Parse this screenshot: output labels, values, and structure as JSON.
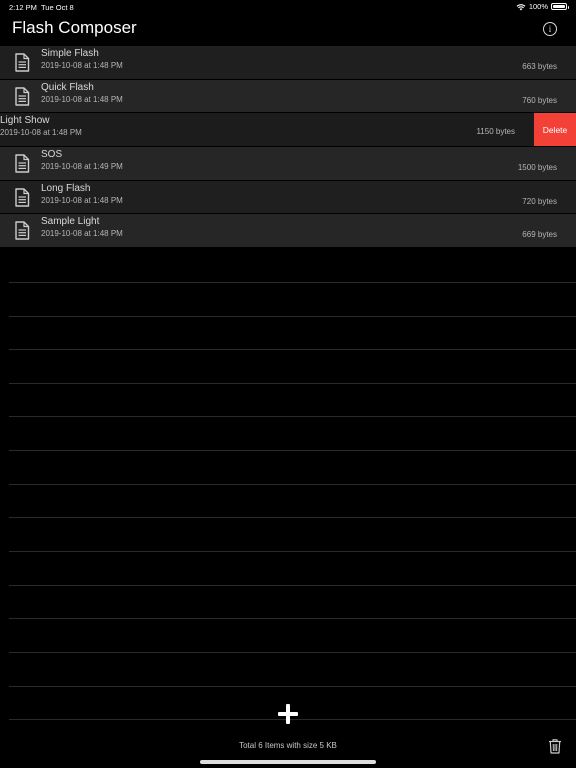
{
  "status_bar": {
    "time": "2:12 PM",
    "date": "Tue Oct 8",
    "battery": "100%"
  },
  "nav": {
    "title": "Flash Composer",
    "info_icon": "info-circle-icon"
  },
  "rows": [
    {
      "title": "Simple Flash",
      "date": "2019-10-08 at 1:48 PM",
      "size": "663 bytes"
    },
    {
      "title": "Quick Flash",
      "date": "2019-10-08 at 1:48 PM",
      "size": "760 bytes"
    },
    {
      "title": "Light Show",
      "date": "2019-10-08 at 1:48 PM",
      "size": "1150 bytes",
      "delete_label": "Delete"
    },
    {
      "title": "SOS",
      "date": "2019-10-08 at 1:49 PM",
      "size": "1500 bytes"
    },
    {
      "title": "Long Flash",
      "date": "2019-10-08 at 1:48 PM",
      "size": "720 bytes"
    },
    {
      "title": "Sample Light",
      "date": "2019-10-08 at 1:48 PM",
      "size": "669 bytes"
    }
  ],
  "footer": {
    "summary": "Total 6 Items with size 5 KB",
    "add_icon": "plus-icon",
    "trash_icon": "trash-icon"
  },
  "colors": {
    "background": "#000000",
    "row_dark": "#1f1f1f",
    "row_light": "#262626",
    "delete": "#f34138"
  }
}
